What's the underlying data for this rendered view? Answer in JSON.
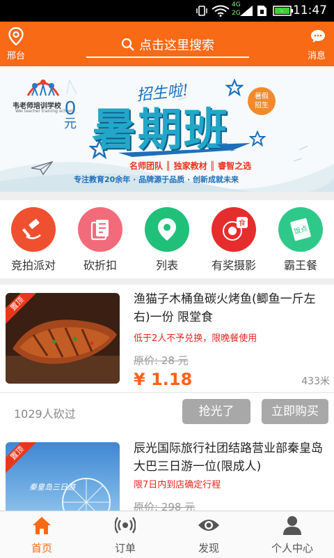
{
  "status_bar": {
    "time": "11:47",
    "network": "4G",
    "network2": "2G"
  },
  "header": {
    "location_label": "邢台",
    "search_placeholder": "点击这里搜索",
    "messages_label": "消息"
  },
  "banner": {
    "school_name": "韦老师培训学校",
    "school_name_en": "Wei teacher training school",
    "recruit": "招生啦!",
    "zero_yuan_a": "0",
    "zero_yuan_b": "元",
    "headline": "暑期班",
    "badge_line1": "暑假",
    "badge_line2": "招生",
    "features": "名师团队 ║ 独家教材 ║ 睿智之选",
    "slogan": "专注教育20余年 · 品牌源于品质 · 创新成就未来"
  },
  "categories": [
    {
      "label": "竞拍派对",
      "icon": "gavel-icon",
      "color": "#ef5030"
    },
    {
      "label": "砍折扣",
      "icon": "coupon-icon",
      "color": "#f26b7a"
    },
    {
      "label": "列表",
      "icon": "location-pin-icon",
      "color": "#21c07a"
    },
    {
      "label": "有奖摄影",
      "icon": "camera-food-icon",
      "color": "#e52d2d"
    },
    {
      "label": "霸王餐",
      "icon": "meal-ticket-icon",
      "color": "#2ec98a"
    }
  ],
  "deals": [
    {
      "tag": "置顶",
      "title": "渔猫子木桶鱼碳火烤鱼(鲫鱼一斤左右)一份 限堂食",
      "rule": "低于2人不予兑换，限晚餐使用",
      "original_price": "原价: 28 元",
      "price": "¥ 1.18",
      "distance": "433米",
      "bargain_count": "1029人砍过",
      "sold_out_label": "抢光了",
      "buy_label": "立即购买"
    },
    {
      "tag": "置顶",
      "title": "辰光国际旅行社团结路营业部秦皇岛大巴三日游一位(限成人)",
      "rule": "限7日内到店确定行程",
      "original_price": "原价: 298 元",
      "image_text": "秦皇岛三日游"
    }
  ],
  "tabbar": [
    {
      "label": "首页",
      "icon": "home-icon",
      "active": true
    },
    {
      "label": "订单",
      "icon": "broadcast-icon",
      "active": false
    },
    {
      "label": "发现",
      "icon": "eye-icon",
      "active": false
    },
    {
      "label": "个人中心",
      "icon": "person-icon",
      "active": false
    }
  ],
  "colors": {
    "brand": "#f96a16",
    "price": "#f7641a",
    "warning": "#e6261e",
    "tab_active": "#f96a16",
    "tab_inactive": "#555555"
  }
}
